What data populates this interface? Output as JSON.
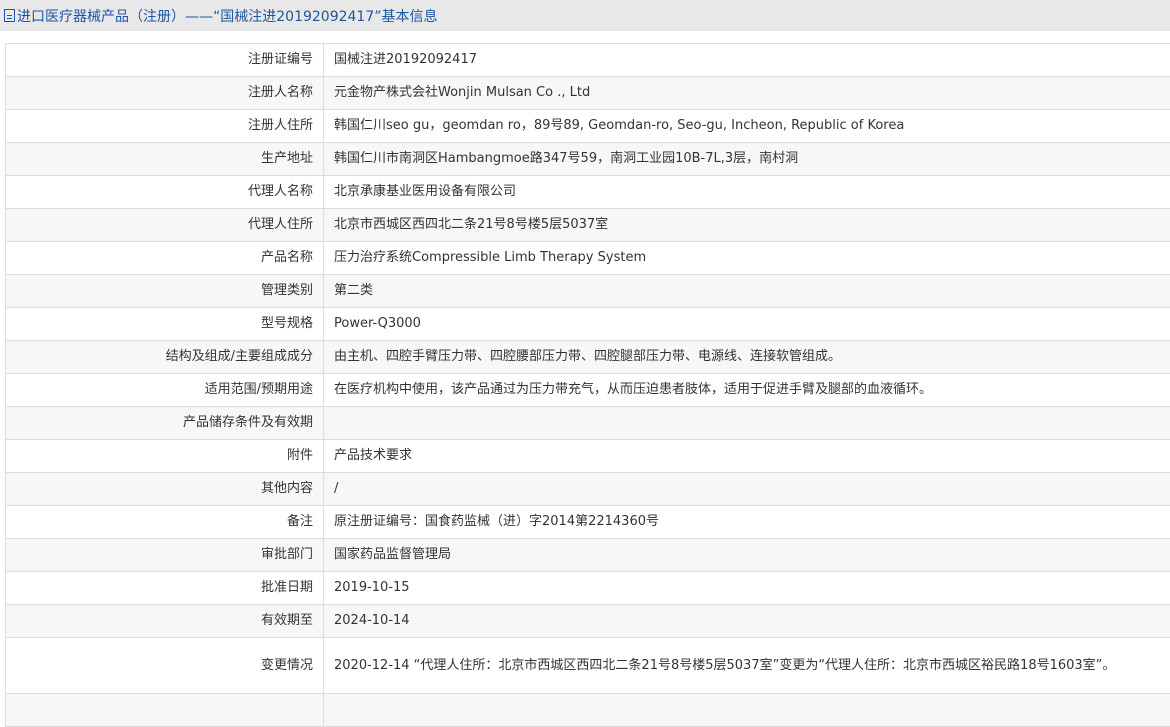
{
  "header": {
    "title": "进口医疗器械产品（注册）——“国械注进20192092417”基本信息"
  },
  "rows": [
    {
      "label": "注册证编号",
      "value": "国械注进20192092417"
    },
    {
      "label": "注册人名称",
      "value": "元金物产株式会社Wonjin Mulsan Co ., Ltd"
    },
    {
      "label": "注册人住所",
      "value": "韩国仁川seo gu，geomdan ro，89号89, Geomdan-ro, Seo-gu, Incheon, Republic of Korea"
    },
    {
      "label": "生产地址",
      "value": "韩国仁川市南洞区Hambangmoe路347号59，南洞工业园10B-7L,3层，南村洞"
    },
    {
      "label": "代理人名称",
      "value": "北京承康基业医用设备有限公司"
    },
    {
      "label": "代理人住所",
      "value": "北京市西城区西四北二条21号8号楼5层5037室"
    },
    {
      "label": "产品名称",
      "value": "压力治疗系统Compressible Limb Therapy System"
    },
    {
      "label": "管理类别",
      "value": "第二类"
    },
    {
      "label": "型号规格",
      "value": "Power-Q3000"
    },
    {
      "label": "结构及组成/主要组成成分",
      "value": "由主机、四腔手臂压力带、四腔腰部压力带、四腔腿部压力带、电源线、连接软管组成。"
    },
    {
      "label": "适用范围/预期用途",
      "value": "在医疗机构中使用，该产品通过为压力带充气，从而压迫患者肢体，适用于促进手臂及腿部的血液循环。"
    },
    {
      "label": "产品储存条件及有效期",
      "value": ""
    },
    {
      "label": "附件",
      "value": "产品技术要求"
    },
    {
      "label": "其他内容",
      "value": "/"
    },
    {
      "label": "备注",
      "value": "原注册证编号：国食药监械（进）字2014第2214360号"
    },
    {
      "label": "审批部门",
      "value": "国家药品监督管理局"
    },
    {
      "label": "批准日期",
      "value": "2019-10-15"
    },
    {
      "label": "有效期至",
      "value": "2024-10-14"
    },
    {
      "label": "变更情况",
      "value": "2020-12-14 “代理人住所：北京市西城区西四北二条21号8号楼5层5037室”变更为“代理人住所：北京市西城区裕民路18号1603室”。"
    }
  ]
}
